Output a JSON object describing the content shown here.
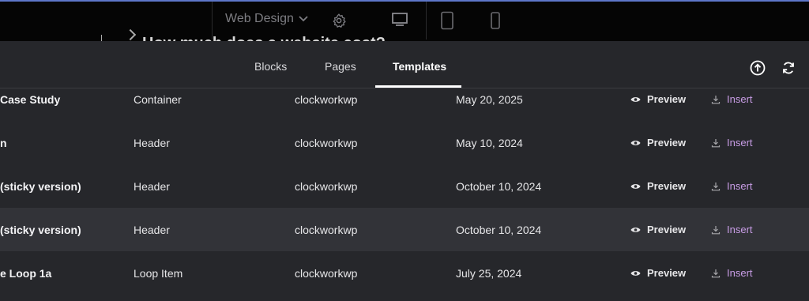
{
  "editor_bar": {
    "site_label": "Web Design",
    "behind_heading": "How much does a website cost?"
  },
  "tabs": [
    {
      "label": "Blocks"
    },
    {
      "label": "Pages"
    },
    {
      "label": "Templates",
      "active": true
    }
  ],
  "actions": {
    "preview_label": "Preview",
    "insert_label": "Insert"
  },
  "rows": [
    {
      "name": "Case Study",
      "type": "Container",
      "author": "clockworkwp",
      "date": "May 20, 2025"
    },
    {
      "name": "n",
      "type": "Header",
      "author": "clockworkwp",
      "date": "May 10, 2024"
    },
    {
      "name": "(sticky version)",
      "type": "Header",
      "author": "clockworkwp",
      "date": "October 10, 2024"
    },
    {
      "name": "(sticky version)",
      "type": "Header",
      "author": "clockworkwp",
      "date": "October 10, 2024",
      "highlighted": true
    },
    {
      "name": "e Loop 1a",
      "type": "Loop Item",
      "author": "clockworkwp",
      "date": "July 25, 2024"
    }
  ],
  "colors": {
    "background": "#26272b",
    "row_highlight": "#323338",
    "insert_accent": "#c89de6",
    "top_bar": "#050505"
  }
}
